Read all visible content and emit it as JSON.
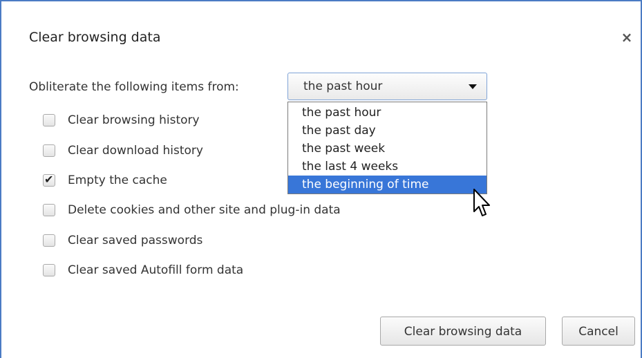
{
  "dialog": {
    "title": "Clear browsing data",
    "close_glyph": "×",
    "period_label": "Obliterate the following items from:",
    "select": {
      "value": "the past hour",
      "options": [
        "the past hour",
        "the past day",
        "the past week",
        "the last 4 weeks",
        "the beginning of time"
      ],
      "highlighted_index": 4
    },
    "checkboxes": [
      {
        "label": "Clear browsing history",
        "checked": false
      },
      {
        "label": "Clear download history",
        "checked": false
      },
      {
        "label": "Empty the cache",
        "checked": true
      },
      {
        "label": "Delete cookies and other site and plug-in data",
        "checked": false
      },
      {
        "label": "Clear saved passwords",
        "checked": false
      },
      {
        "label": "Clear saved Autofill form data",
        "checked": false
      }
    ],
    "buttons": {
      "clear": "Clear browsing data",
      "cancel": "Cancel"
    }
  },
  "colors": {
    "border_accent": "#4a7bc4",
    "highlight": "#3876d8"
  },
  "icons": {
    "close": "close-icon",
    "dropdown": "chevron-down-icon",
    "check": "checkmark-icon",
    "cursor": "mouse-pointer-icon"
  }
}
